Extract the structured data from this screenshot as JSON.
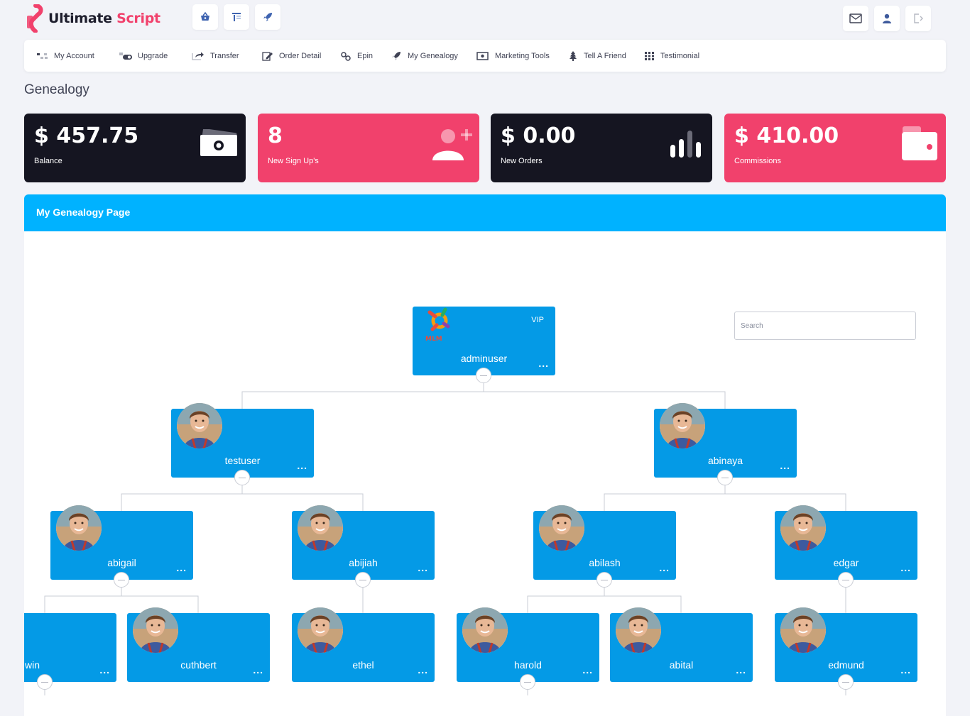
{
  "brand": {
    "name_part1": "Ultimate",
    "name_part2": "Script"
  },
  "header": {
    "quick_icons": [
      "shopping-basket-icon",
      "layout-icon",
      "rocket-icon"
    ],
    "right_icons": [
      "envelope-icon",
      "user-icon",
      "logout-icon"
    ]
  },
  "nav": [
    {
      "label": "My Account",
      "icon": "dashboard-icon"
    },
    {
      "label": "Upgrade",
      "icon": "toggle-icon"
    },
    {
      "label": "Transfer",
      "icon": "share-icon"
    },
    {
      "label": "Order Detail",
      "icon": "edit-icon"
    },
    {
      "label": "Epin",
      "icon": "link-icon"
    },
    {
      "label": "My Genealogy",
      "icon": "rocket-icon"
    },
    {
      "label": "Marketing Tools",
      "icon": "money-icon"
    },
    {
      "label": "Tell A Friend",
      "icon": "tree-icon"
    },
    {
      "label": "Testimonial",
      "icon": "grid-icon"
    }
  ],
  "page": {
    "title": "Genealogy"
  },
  "stats": [
    {
      "value": "$ 457.75",
      "label": "Balance",
      "icon": "money-bill-icon",
      "color": "#151521"
    },
    {
      "value": "8",
      "label": "New Sign Up's",
      "icon": "user-plus-icon",
      "color": "#f1416c"
    },
    {
      "value": "$ 0.00",
      "label": "New Orders",
      "icon": "bar-chart-icon",
      "color": "#151521"
    },
    {
      "value": "$ 410.00",
      "label": "Commissions",
      "icon": "wallet-icon",
      "color": "#f1416c"
    }
  ],
  "panel": {
    "title": "My Genealogy Page",
    "accent": "#00b2ff"
  },
  "search": {
    "placeholder": "Search",
    "value": ""
  },
  "tree": {
    "node_color": "#049ae6",
    "root": {
      "name": "adminuser",
      "badge": "VIP",
      "logo_text": "MLM"
    },
    "level1": [
      "testuser",
      "abinaya"
    ],
    "level2": [
      "abigail",
      "abijiah",
      "abilash",
      "edgar"
    ],
    "level3": [
      "win",
      "cuthbert",
      "ethel",
      "harold",
      "abital",
      "edmund"
    ],
    "more": "..."
  }
}
